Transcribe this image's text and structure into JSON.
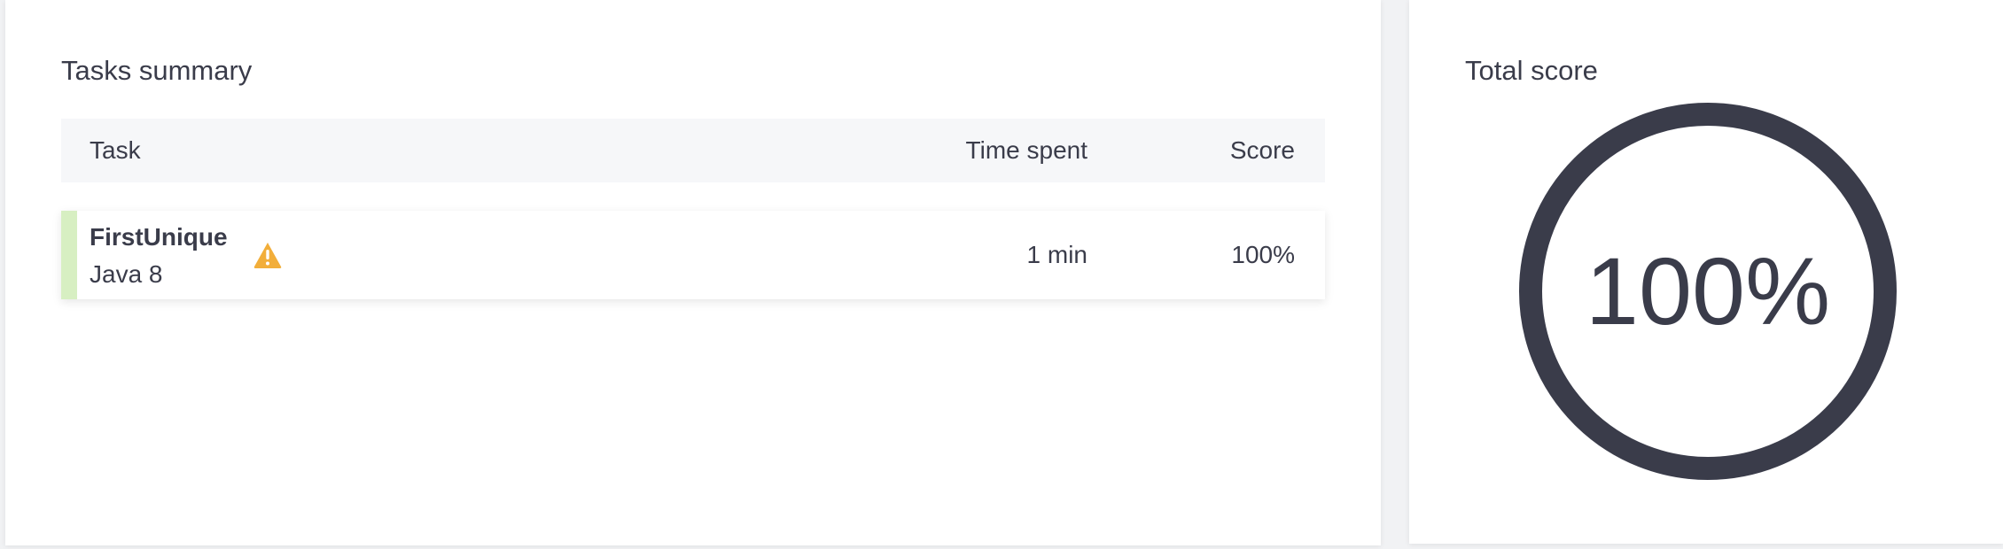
{
  "tasks_summary": {
    "title": "Tasks summary",
    "columns": {
      "task": "Task",
      "time_spent": "Time spent",
      "score": "Score"
    },
    "rows": [
      {
        "name": "FirstUnique",
        "language": "Java 8",
        "time_spent": "1 min",
        "score": "100%",
        "icon": "warning-icon",
        "status_color": "#d7efc2"
      }
    ]
  },
  "total_score": {
    "title": "Total score",
    "value": "100%",
    "fraction": 1.0,
    "ring_color": "#3a3c4a"
  },
  "colors": {
    "warning": "#f2ae3a",
    "text": "#3a3c4a"
  }
}
